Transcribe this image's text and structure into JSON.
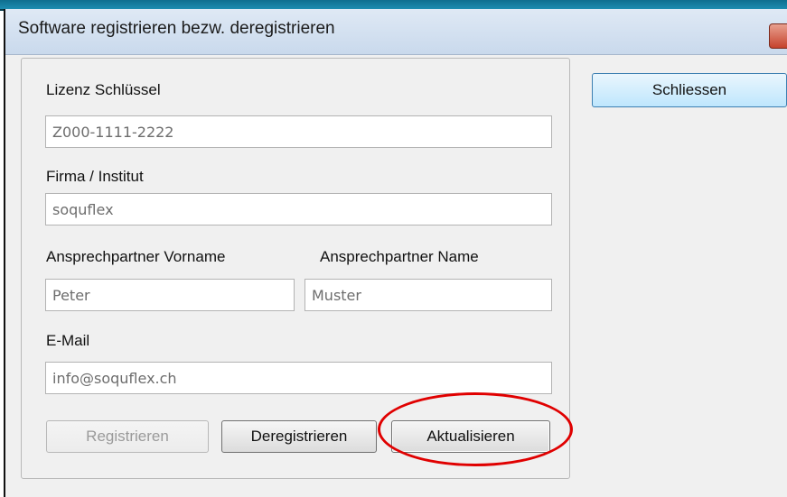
{
  "window": {
    "title": "Software registrieren bezw. deregistrieren"
  },
  "form": {
    "license_key_label": "Lizenz Schlüssel",
    "license_key_value": "Z000-1111-2222",
    "company_label": "Firma / Institut",
    "company_value": "soquflex",
    "firstname_label": "Ansprechpartner Vorname",
    "firstname_value": "Peter",
    "lastname_label": "Ansprechpartner Name",
    "lastname_value": "Muster",
    "email_label": "E-Mail",
    "email_value": "info@soquflex.ch"
  },
  "buttons": {
    "register": "Registrieren",
    "deregister": "Deregistrieren",
    "update": "Aktualisieren",
    "close": "Schliessen"
  },
  "annotation": {
    "highlight_color": "#e00000",
    "highlight_target": "update-button"
  }
}
